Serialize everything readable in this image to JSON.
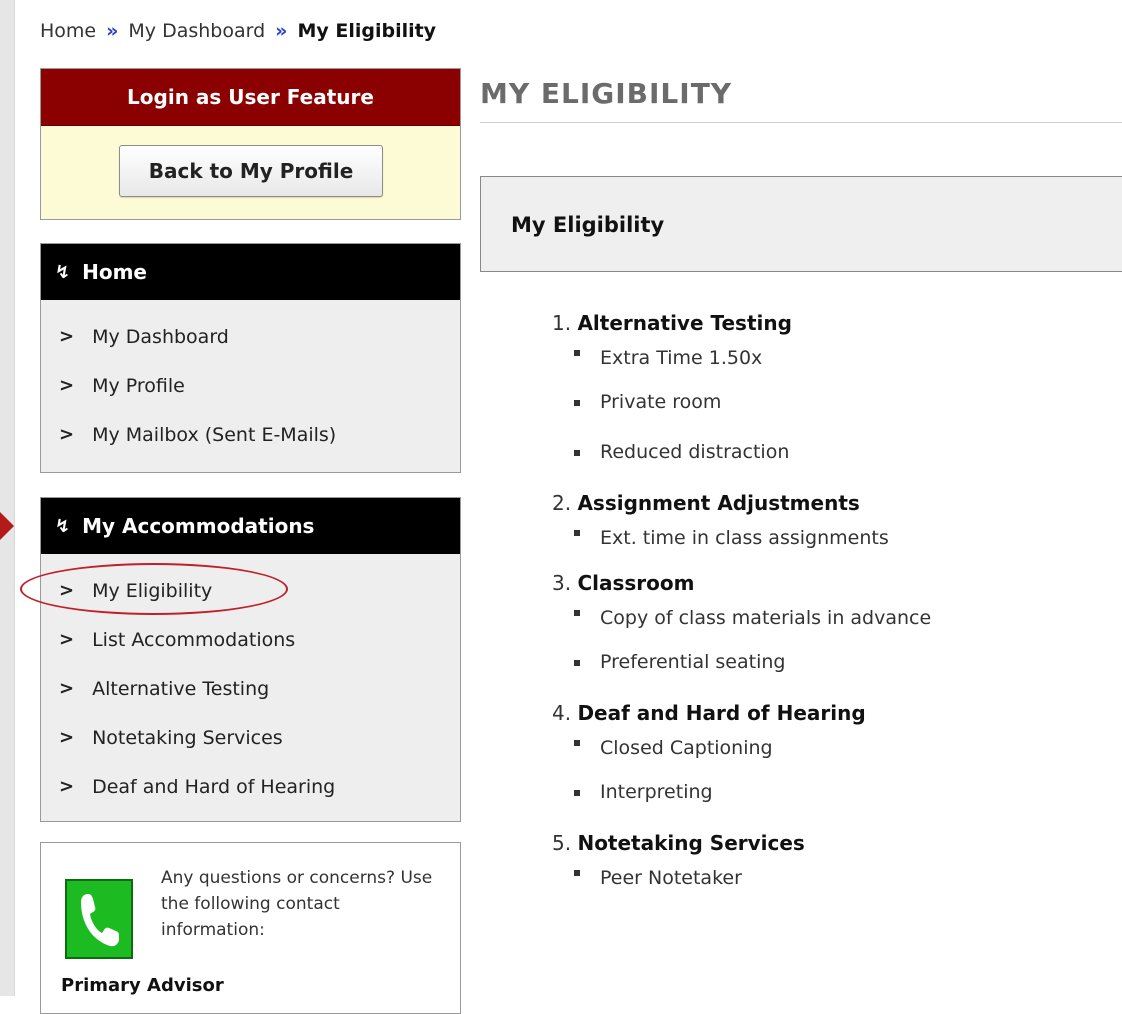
{
  "breadcrumb": {
    "items": [
      "Home",
      "My Dashboard",
      "My Eligibility"
    ],
    "separator": "»"
  },
  "login_box": {
    "header": "Login as User Feature",
    "button_label": "Back to My Profile"
  },
  "home_menu": {
    "title": "Home",
    "items": [
      {
        "label": "My Dashboard"
      },
      {
        "label": "My Profile"
      },
      {
        "label": "My Mailbox (Sent E-Mails)"
      }
    ]
  },
  "accommodations_menu": {
    "title": "My Accommodations",
    "items": [
      {
        "label": "My Eligibility"
      },
      {
        "label": "List Accommodations"
      },
      {
        "label": "Alternative Testing"
      },
      {
        "label": "Notetaking Services"
      },
      {
        "label": "Deaf and Hard of Hearing"
      }
    ]
  },
  "contact": {
    "text": "Any questions or concerns? Use the following contact information:",
    "advisor_label": "Primary Advisor",
    "icon": "phone-icon"
  },
  "main": {
    "page_title": "MY ELIGIBILITY",
    "panel_title": "My Eligibility",
    "categories": [
      {
        "number": "1.",
        "name": "Alternative Testing",
        "items": [
          "Extra Time 1.50x",
          "Private room",
          "Reduced distraction"
        ]
      },
      {
        "number": "2.",
        "name": "Assignment Adjustments",
        "items": [
          "Ext. time in class assignments"
        ]
      },
      {
        "number": "3.",
        "name": "Classroom",
        "items": [
          "Copy of class materials in advance",
          "Preferential seating"
        ]
      },
      {
        "number": "4.",
        "name": "Deaf and Hard of Hearing",
        "items": [
          "Closed Captioning",
          "Interpreting"
        ]
      },
      {
        "number": "5.",
        "name": "Notetaking Services",
        "items": [
          "Peer Notetaker"
        ]
      }
    ]
  },
  "colors": {
    "login_header_bg": "#8b0000",
    "menu_header_bg": "#000000",
    "highlight_oval": "#c0202a",
    "breadcrumb_separator": "#2b3fd0",
    "phone_icon_bg": "#1dbb22"
  }
}
